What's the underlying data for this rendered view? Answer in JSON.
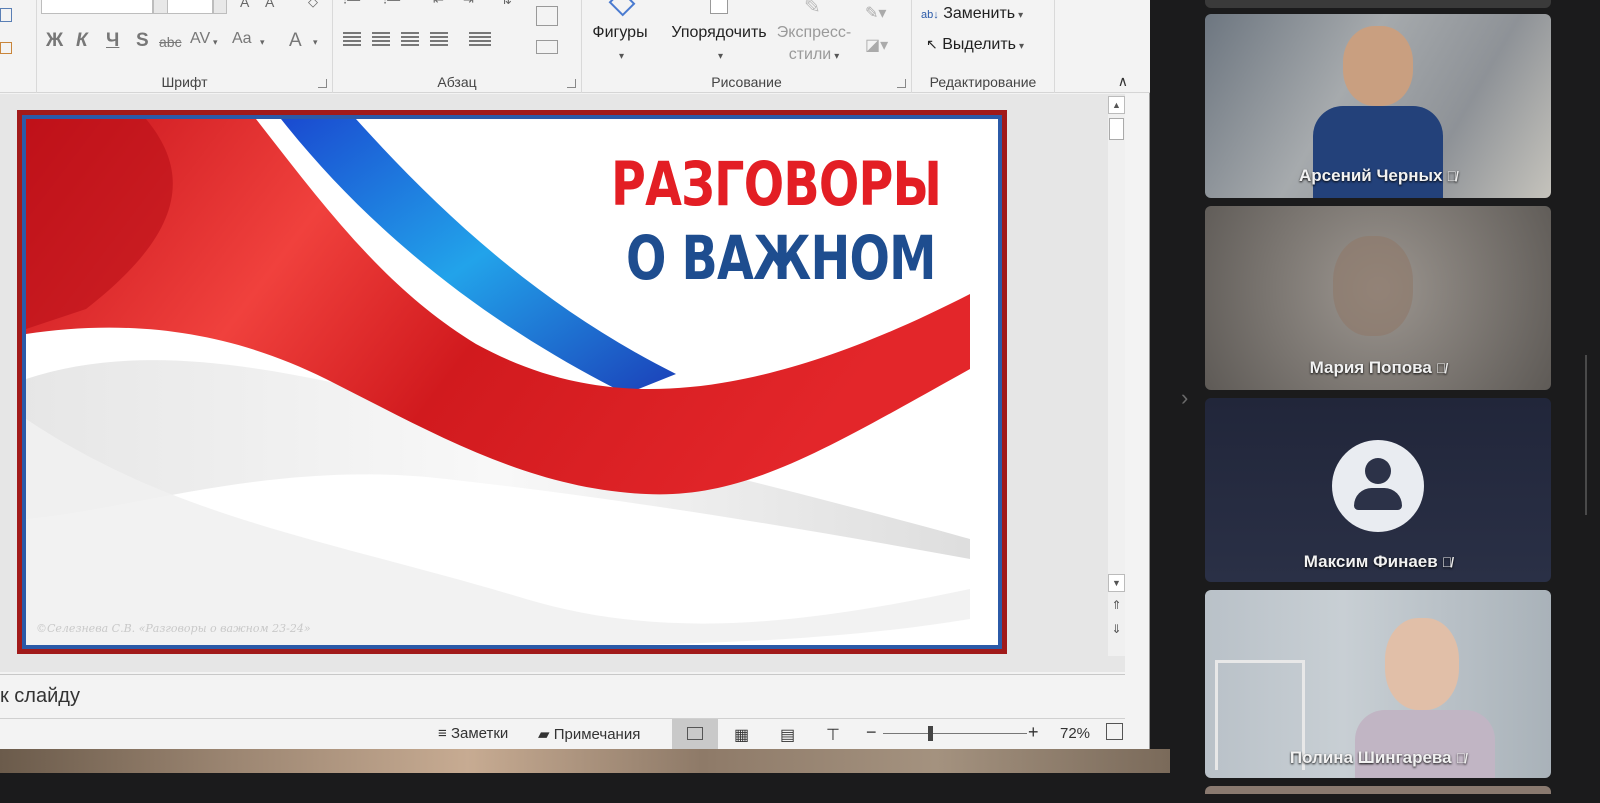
{
  "ribbon": {
    "font_group_label": "Шрифт",
    "paragraph_group_label": "Абзац",
    "drawing_group_label": "Рисование",
    "editing_group_label": "Редактирование",
    "shapes_label": "Фигуры",
    "arrange_label": "Упорядочить",
    "quick_styles_line1": "Экспресс-",
    "quick_styles_line2": "стили",
    "replace_label": "Заменить",
    "select_label": "Выделить",
    "font_buttons": {
      "bold": "Ж",
      "italic": "К",
      "underline": "Ч",
      "shadow": "S",
      "strike": "abc",
      "spacing": "AV",
      "case": "Aa",
      "color": "A"
    }
  },
  "slide": {
    "title_line1": "РАЗГОВОРЫ",
    "title_line2": "О ВАЖНОМ",
    "credit": "©Селезнева С.В. «Разговоры о важном 23-24»",
    "colors": {
      "red": "#e31e24",
      "blue": "#1e4d8f",
      "frame": "#a11a1a"
    }
  },
  "notes": {
    "placeholder": "к слайду"
  },
  "statusbar": {
    "notes_label": "Заметки",
    "comments_label": "Примечания",
    "zoom_level": "72%"
  },
  "participants": [
    {
      "name": "Арсений Черных",
      "muted": true,
      "video": true
    },
    {
      "name": "Мария Попова",
      "muted": true,
      "video": true
    },
    {
      "name": "Максим Финаев",
      "muted": true,
      "video": false
    },
    {
      "name": "Полина Шингарева",
      "muted": true,
      "video": true
    }
  ],
  "icons": {
    "mic_muted": "mic-off-icon",
    "expand": "chevron-right-icon",
    "avatar": "user-avatar-icon"
  }
}
